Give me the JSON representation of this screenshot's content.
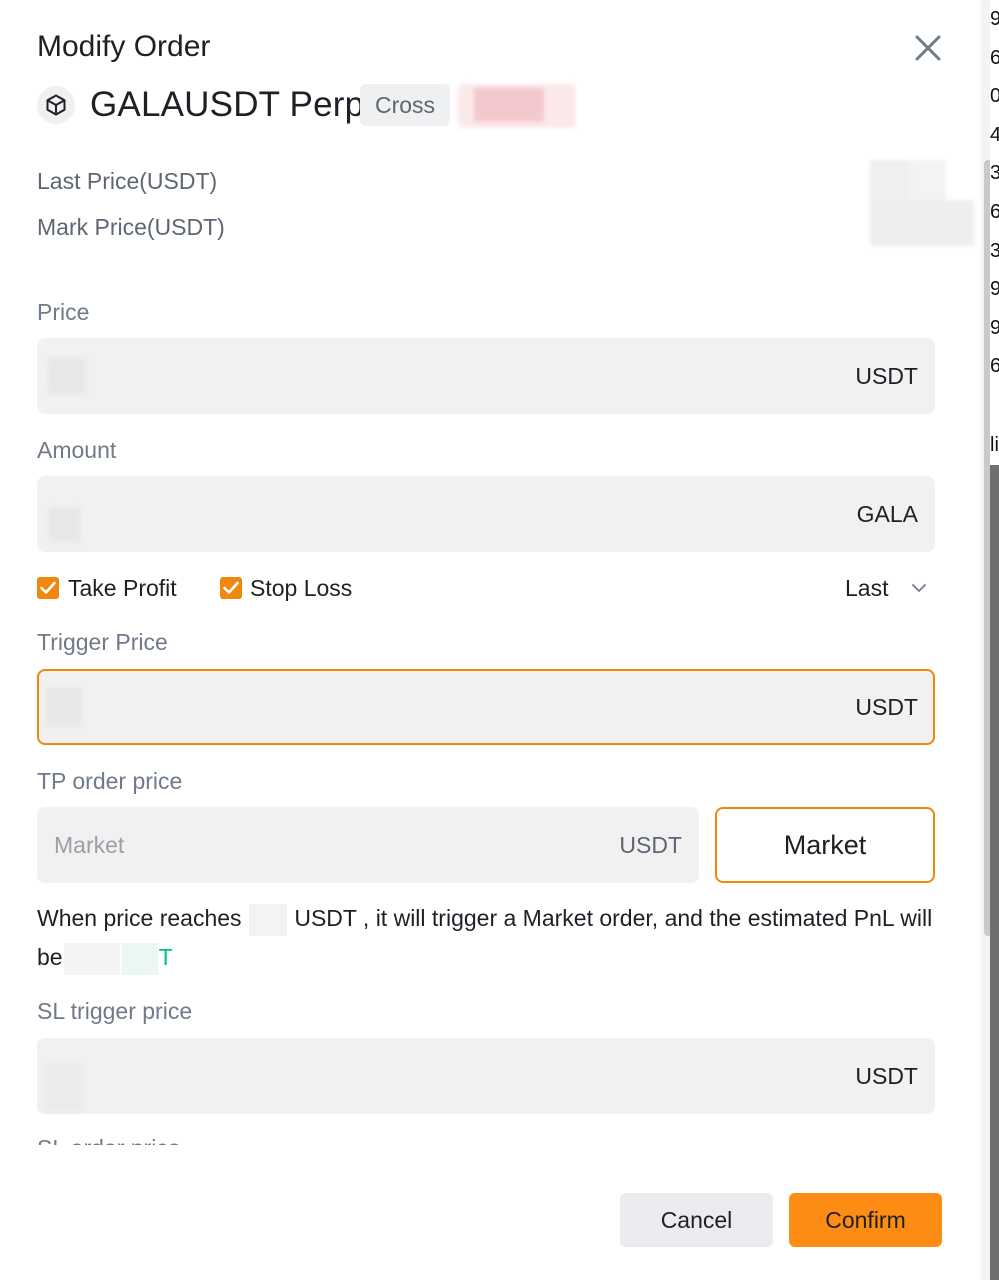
{
  "dialog": {
    "title": "Modify Order",
    "symbol": "GALAUSDT Perp",
    "margin_mode": "Cross"
  },
  "prices": {
    "last_price_label": "Last Price(USDT)",
    "mark_price_label": "Mark Price(USDT)"
  },
  "price_field": {
    "label": "Price",
    "unit": "USDT"
  },
  "amount_field": {
    "label": "Amount",
    "unit": "GALA"
  },
  "options": {
    "take_profit_label": "Take Profit",
    "stop_loss_label": "Stop Loss",
    "trigger_type": "Last"
  },
  "trigger_price_field": {
    "label": "Trigger Price",
    "unit": "USDT"
  },
  "tp_order_price": {
    "label": "TP order price",
    "placeholder": "Market",
    "unit": "USDT",
    "type_button": "Market"
  },
  "info": {
    "part1": "When price reaches",
    "part2": "USDT , it will trigger a Market order, and the estimated PnL will be",
    "pnl_suffix": "T"
  },
  "sl_trigger_field": {
    "label": "SL trigger price",
    "unit": "USDT"
  },
  "sl_order_price_label_partial": "SL order price",
  "footer": {
    "cancel": "Cancel",
    "confirm": "Confirm"
  },
  "edge_digits": [
    "9",
    "6",
    "0",
    "4",
    "3",
    "6",
    "3",
    "9",
    "9",
    "6"
  ],
  "edge_glyph": "li",
  "colors": {
    "accent": "#f0880f",
    "confirm": "#fc8c14",
    "profit": "#03c087"
  }
}
